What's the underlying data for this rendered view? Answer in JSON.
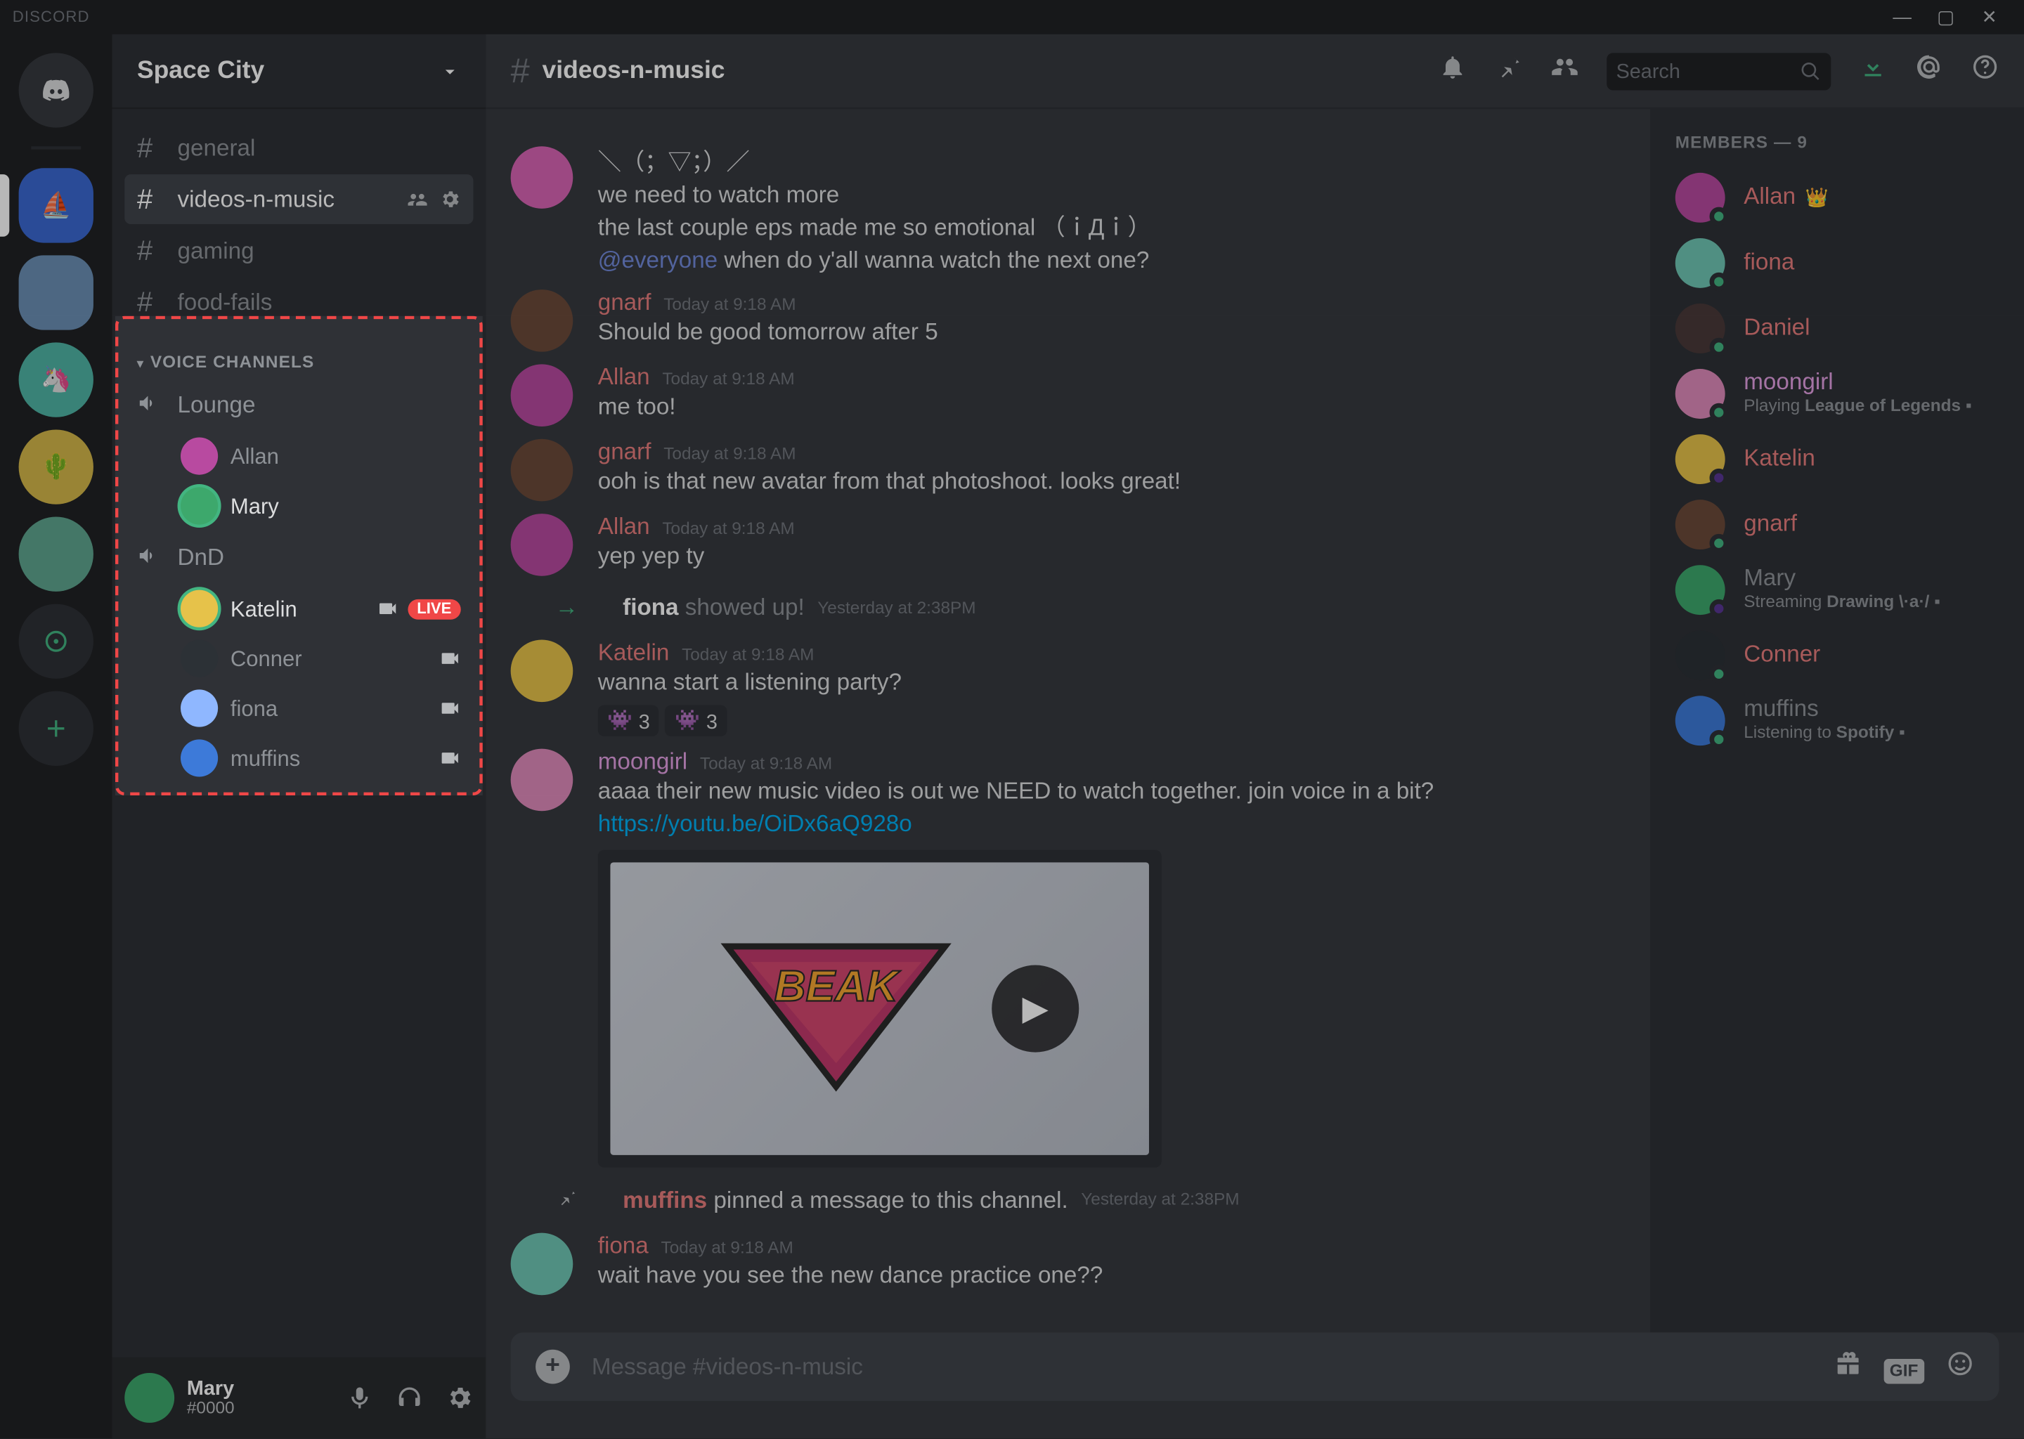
{
  "app_name": "DISCORD",
  "window_controls": {
    "min": "—",
    "max": "▢",
    "close": "✕"
  },
  "server_name": "Space City",
  "text_channels": [
    {
      "name": "general",
      "selected": false
    },
    {
      "name": "videos-n-music",
      "selected": true,
      "show_hover_icons": true
    },
    {
      "name": "gaming",
      "selected": false
    },
    {
      "name": "food-fails",
      "selected": false
    }
  ],
  "voice_header": "VOICE CHANNELS",
  "voice_channels": [
    {
      "name": "Lounge",
      "users": [
        {
          "name": "Allan",
          "avatar_bg": "#b84aa0",
          "speaking": false
        },
        {
          "name": "Mary",
          "avatar_bg": "#3da86c",
          "speaking": true
        }
      ]
    },
    {
      "name": "DnD",
      "users": [
        {
          "name": "Katelin",
          "avatar_bg": "#e6c24a",
          "speaking": true,
          "camera": true,
          "live": true
        },
        {
          "name": "Conner",
          "avatar_bg": "#2c3136",
          "speaking": false,
          "camera": true
        },
        {
          "name": "fiona",
          "avatar_bg": "#8fb7ff",
          "speaking": false,
          "camera": true
        },
        {
          "name": "muffins",
          "avatar_bg": "#3d7ad9",
          "speaking": false,
          "camera": true
        }
      ]
    }
  ],
  "live_label": "LIVE",
  "user_area": {
    "name": "Mary",
    "tag": "#0000",
    "avatar_bg": "#3da86c"
  },
  "chat_title": "videos-n-music",
  "search_placeholder": "Search",
  "messages": [
    {
      "type": "msg",
      "author": "",
      "author_color": "#e4a0e4",
      "avatar_bg": "#d864b5",
      "continued": true,
      "lines": [
        "＼（；▽；）／",
        "we need to watch more",
        "the last couple eps made me so emotional （ｉДｉ）"
      ],
      "mention_line": {
        "mention": "@everyone",
        "text": " when do y'all wanna watch the next one?"
      }
    },
    {
      "type": "msg",
      "author": "gnarf",
      "author_color": "#e87d7d",
      "avatar_bg": "#6b4a3a",
      "ts": "Today at 9:18 AM",
      "lines": [
        "Should be good tomorrow after 5"
      ]
    },
    {
      "type": "msg",
      "author": "Allan",
      "author_color": "#e87d7d",
      "avatar_bg": "#b84aa0",
      "ts": "Today at 9:18 AM",
      "lines": [
        "me too!"
      ]
    },
    {
      "type": "msg",
      "author": "gnarf",
      "author_color": "#e87d7d",
      "avatar_bg": "#6b4a3a",
      "ts": "Today at 9:18 AM",
      "lines": [
        "ooh is that new avatar from that photoshoot. looks great!"
      ]
    },
    {
      "type": "msg",
      "author": "Allan",
      "author_color": "#e87d7d",
      "avatar_bg": "#b84aa0",
      "ts": "Today at 9:18 AM",
      "lines": [
        "yep yep ty"
      ]
    },
    {
      "type": "system_join",
      "user": "fiona",
      "text": " showed up!",
      "ts": "Yesterday at 2:38PM"
    },
    {
      "type": "msg",
      "author": "Katelin",
      "author_color": "#e87d7d",
      "avatar_bg": "#e6c24a",
      "ts": "Today at 9:18 AM",
      "lines": [
        "wanna start a listening party?"
      ],
      "reactions": [
        {
          "emoji": "👾",
          "count": 3
        },
        {
          "emoji": "👾",
          "count": 3
        }
      ]
    },
    {
      "type": "msg",
      "author": "moongirl",
      "author_color": "#e4a0e4",
      "avatar_bg": "#e08bbb",
      "ts": "Today at 9:18 AM",
      "lines": [
        "aaaa their new music video is out we NEED to watch together. join voice in a bit?"
      ],
      "link": "https://youtu.be/OiDx6aQ928o",
      "embed": true
    },
    {
      "type": "system_pin",
      "user": "muffins",
      "text": " pinned a message to this channel.",
      "ts": "Yesterday at 2:38PM"
    },
    {
      "type": "msg",
      "author": "fiona",
      "author_color": "#e87d7d",
      "avatar_bg": "#6fc7b5",
      "ts": "Today at 9:18 AM",
      "lines": [
        "wait have you see the new dance practice one??"
      ]
    }
  ],
  "input_placeholder": "Message #videos-n-music",
  "input_gif": "GIF",
  "members_header": "MEMBERS — 9",
  "members": [
    {
      "name": "Allan",
      "color": "#e87d7d",
      "avatar_bg": "#b84aa0",
      "status": "#43b581",
      "crown": true
    },
    {
      "name": "fiona",
      "color": "#e87d7d",
      "avatar_bg": "#6fc7b5",
      "status": "#43b581"
    },
    {
      "name": "Daniel",
      "color": "#e87d7d",
      "avatar_bg": "#4a3a3a",
      "status": "#43b581"
    },
    {
      "name": "moongirl",
      "color": "#e4a0e4",
      "avatar_bg": "#e08bbb",
      "status": "#43b581",
      "sub_prefix": "Playing ",
      "sub_bold": "League of Legends"
    },
    {
      "name": "Katelin",
      "color": "#e87d7d",
      "avatar_bg": "#e6c24a",
      "status": "#593695"
    },
    {
      "name": "gnarf",
      "color": "#e87d7d",
      "avatar_bg": "#6b4a3a",
      "status": "#43b581"
    },
    {
      "name": "Mary",
      "color": "#8e9297",
      "avatar_bg": "#3da86c",
      "status": "#593695",
      "sub_prefix": "Streaming ",
      "sub_bold": "Drawing \\·a·/"
    },
    {
      "name": "Conner",
      "color": "#e87d7d",
      "avatar_bg": "#2c3136",
      "status": "#43b581"
    },
    {
      "name": "muffins",
      "color": "#8e9297",
      "avatar_bg": "#3d7ad9",
      "status": "#43b581",
      "sub_prefix": "Listening to ",
      "sub_bold": "Spotify"
    }
  ],
  "colors": {
    "selected_guild_bg": "#5865f2",
    "author_system": "#8e9297"
  }
}
